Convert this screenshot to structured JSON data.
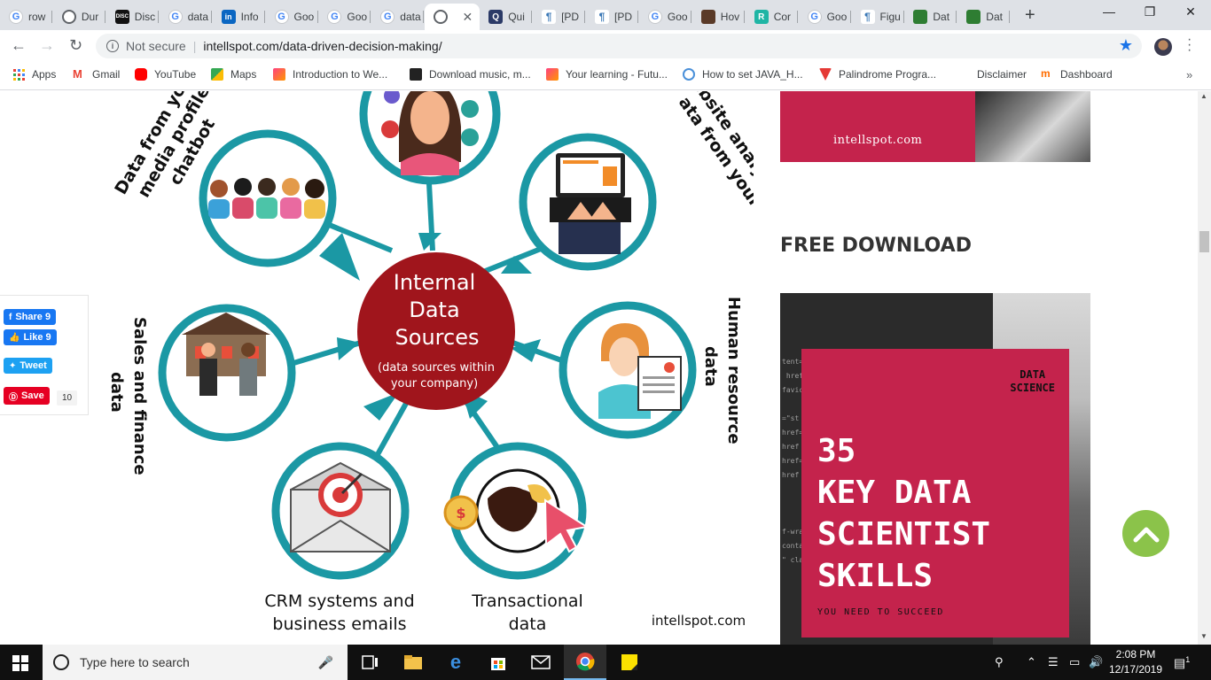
{
  "browser": {
    "tabs": [
      {
        "title": "row",
        "icon": "google-icon"
      },
      {
        "title": "Dur",
        "icon": "globe-icon"
      },
      {
        "title": "Disc",
        "icon": "discogs-icon"
      },
      {
        "title": "data",
        "icon": "google-icon"
      },
      {
        "title": "Info",
        "icon": "linkedin-icon"
      },
      {
        "title": "Goo",
        "icon": "google-icon"
      },
      {
        "title": "Goo",
        "icon": "google-icon"
      },
      {
        "title": "data",
        "icon": "google-icon"
      },
      {
        "title": "",
        "icon": "globe-icon",
        "active": true
      },
      {
        "title": "Qui",
        "icon": "quizlet-icon"
      },
      {
        "title": "[PD",
        "icon": "pdf-icon"
      },
      {
        "title": "[PD",
        "icon": "pdf-icon"
      },
      {
        "title": "Goo",
        "icon": "google-icon"
      },
      {
        "title": "Hov",
        "icon": "howto-icon"
      },
      {
        "title": "Cor",
        "icon": "r-icon"
      },
      {
        "title": "Goo",
        "icon": "google-icon"
      },
      {
        "title": "Figu",
        "icon": "pdf-icon"
      },
      {
        "title": "Dat",
        "icon": "data-icon"
      },
      {
        "title": "Dat",
        "icon": "data-icon"
      }
    ],
    "security_label": "Not secure",
    "url": "intellspot.com/data-driven-decision-making/",
    "bookmarks": [
      {
        "label": "Apps"
      },
      {
        "label": "Gmail"
      },
      {
        "label": "YouTube"
      },
      {
        "label": "Maps"
      },
      {
        "label": "Introduction to We..."
      },
      {
        "label": "Download music, m..."
      },
      {
        "label": "Your learning - Futu..."
      },
      {
        "label": "How to set JAVA_H..."
      },
      {
        "label": "Palindrome Progra..."
      },
      {
        "label": "Disclaimer"
      },
      {
        "label": "Dashboard"
      }
    ],
    "more_bookmarks": "»"
  },
  "share": {
    "fb_share": "Share 9",
    "fb_like": "Like 9",
    "tweet": "Tweet",
    "pin_save": "Save",
    "pin_count": "10"
  },
  "infographic": {
    "center_title": "Internal Data Sources",
    "center_title_lines": [
      "Internal",
      "Data",
      "Sources"
    ],
    "center_subtitle_lines": [
      "(data sources within",
      "your company)"
    ],
    "labels": {
      "social_lines": [
        "Data from your",
        "media profiles a",
        "chatbot"
      ],
      "web_lines": [
        "ata from your",
        "website analytics"
      ],
      "sales_lines": [
        "Sales and finance",
        "data"
      ],
      "hr_lines": [
        "Human resource",
        "data"
      ],
      "crm_lines": [
        "CRM systems and",
        "business emails"
      ],
      "transactional_lines": [
        "Transactional",
        "data"
      ]
    },
    "watermark": "intellspot.com",
    "colors": {
      "ring": "#1b98a4",
      "center": "#a0151c"
    }
  },
  "sidebar": {
    "ad_top_brand": "intellspot.com",
    "free_download": "FREE DOWNLOAD",
    "ad_tag_lines": [
      "DATA",
      "SCIENCE"
    ],
    "ad_headline_lines": [
      "35",
      "KEY DATA",
      "SCIENTIST",
      "SKILLS"
    ],
    "ad_sub": "YOU NEED TO SUCCEED",
    "accent": "#c4234c",
    "back_to_top": "chevron-up-icon"
  },
  "taskbar": {
    "search_placeholder": "Type here to search",
    "time": "2:08 PM",
    "date": "12/17/2019",
    "notifications": "1"
  }
}
